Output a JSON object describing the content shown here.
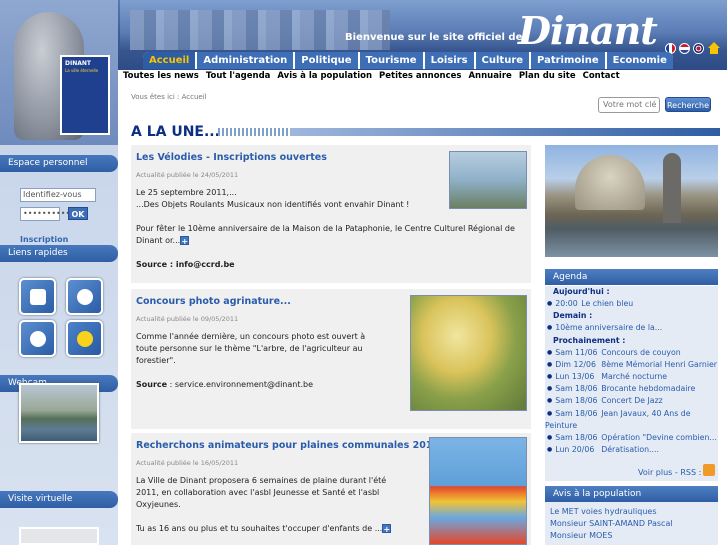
{
  "header": {
    "welcome": "Bienvenue sur le site officiel de",
    "logo_text": "Dinant",
    "statue_logo": "DINANT",
    "statue_logo_sub": "La ville éternelle"
  },
  "main_nav": [
    "Accueil",
    "Administration",
    "Politique",
    "Tourisme",
    "Loisirs",
    "Culture",
    "Patrimoine",
    "Economie"
  ],
  "sub_nav": [
    "Toutes les news",
    "Tout l'agenda",
    "Avis à la population",
    "Petites annonces",
    "Annuaire",
    "Plan du site",
    "Contact"
  ],
  "breadcrumb": "Vous êtes ici :  Accueil",
  "search": {
    "placeholder": "Votre mot clé",
    "button": "Recherche"
  },
  "une_title": "A LA UNE...",
  "sidebar": {
    "espace": "Espace personnel",
    "login_placeholder": "Identifiez-vous",
    "password_value": "••••••••••",
    "ok": "OK",
    "inscription": "Inscription",
    "liens": "Liens rapides",
    "webcam": "Webcam",
    "visite": "Visite virtuelle"
  },
  "news": [
    {
      "title": "Les Vélodies - Inscriptions ouvertes",
      "date": "Actualité publiée le 24/05/2011",
      "p1": "Le 25 septembre 2011,...",
      "p2": "...Des Objets Roulants Musicaux non identifiés vont envahir Dinant !",
      "p3": "Pour fêter le 10ème anniversaire de la Maison de la Pataphonie, le Centre Culturel Régional de Dinant or...",
      "source_label": "Source : ",
      "source": "info@ccrd.be"
    },
    {
      "title": "Concours photo agrinature...",
      "date": "Actualité publiée le 09/05/2011",
      "p1": "Comme l'année dernière, un concours photo est ouvert à toute personne sur le thème \"L'arbre, de l'agriculteur au forestier\".",
      "source_label": "Source",
      "source": " : service.environnement@dinant.be"
    },
    {
      "title": "Recherchons animateurs pour plaines communales 2011 !",
      "date": "Actualité publiée le 16/05/2011",
      "p1": "La Ville de Dinant proposera 6 semaines de plaine durant l'été 2011, en collaboration avec l'asbl Jeunesse et Santé et l'asbl Oxyjeunes.",
      "p2": "Tu as 16 ans ou plus et tu souhaites t'occuper d'enfants de ..."
    }
  ],
  "agenda": {
    "title": "Agenda",
    "today_label": "Aujourd'hui :",
    "today": [
      {
        "date": "20:00",
        "text": "Le chien bleu"
      }
    ],
    "tomorrow_label": "Demain :",
    "tomorrow": [
      {
        "date": "",
        "text": "10ème anniversaire de la..."
      }
    ],
    "soon_label": "Prochainement :",
    "soon": [
      {
        "date": "Sam 11/06",
        "text": "Concours de couyon"
      },
      {
        "date": "Dim 12/06",
        "text": "8ème Mémorial Henri Garnier"
      },
      {
        "date": "Lun 13/06",
        "text": "Marché nocturne"
      },
      {
        "date": "Sam 18/06",
        "text": "Brocante hebdomadaire"
      },
      {
        "date": "Sam 18/06",
        "text": "Concert De Jazz"
      },
      {
        "date": "Sam 18/06",
        "text": "Jean Javaux, 40 Ans de"
      },
      {
        "date": "",
        "text": "Peinture"
      },
      {
        "date": "Sam 18/06",
        "text": "Opération \"Devine combien..."
      },
      {
        "date": "Lun 20/06",
        "text": "Dératisation...."
      }
    ],
    "voir_plus": "Voir plus - RSS :"
  },
  "population": {
    "title": "Avis à la population",
    "items": [
      "Le MET voies hydrauliques",
      "Monsieur SAINT-AMAND Pascal",
      "Monsieur MOES"
    ]
  },
  "colors": {
    "nav_blue": "#3e6fb6",
    "title_navy": "#0c2f82",
    "link_blue": "#2a5cac",
    "accent_yellow": "#f7c600"
  }
}
